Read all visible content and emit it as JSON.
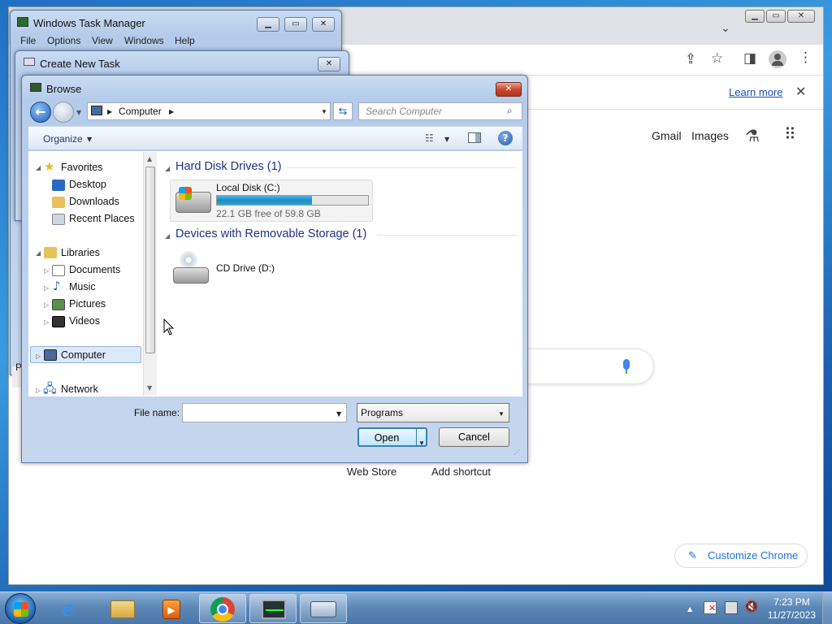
{
  "chrome": {
    "infobar_link": "Learn more",
    "links": [
      "Gmail",
      "Images"
    ],
    "shortcuts": [
      "Web Store",
      "Add shortcut"
    ],
    "customize": "Customize Chrome"
  },
  "task_manager": {
    "title": "Windows Task Manager",
    "menu": [
      "File",
      "Options",
      "View",
      "Windows",
      "Help"
    ],
    "partial_letter": "P"
  },
  "create_task": {
    "title": "Create New Task"
  },
  "browse": {
    "title": "Browse",
    "breadcrumb": "Computer",
    "search_placeholder": "Search Computer",
    "organize": "Organize",
    "nav": {
      "favorites": "Favorites",
      "favorites_items": [
        "Desktop",
        "Downloads",
        "Recent Places"
      ],
      "libraries": "Libraries",
      "libraries_items": [
        "Documents",
        "Music",
        "Pictures",
        "Videos"
      ],
      "computer": "Computer",
      "network": "Network"
    },
    "groups": {
      "hdd": "Hard Disk Drives (1)",
      "removable": "Devices with Removable Storage (1)"
    },
    "drives": {
      "local_name": "Local Disk (C:)",
      "local_free": "22.1 GB free of 59.8 GB",
      "local_used_fraction": 0.63,
      "cd_name": "CD Drive (D:)"
    },
    "file_name_label": "File name:",
    "file_name_value": "",
    "filter": "Programs",
    "open": "Open",
    "cancel": "Cancel"
  },
  "taskbar": {
    "time": "7:23 PM",
    "date": "11/27/2023"
  }
}
